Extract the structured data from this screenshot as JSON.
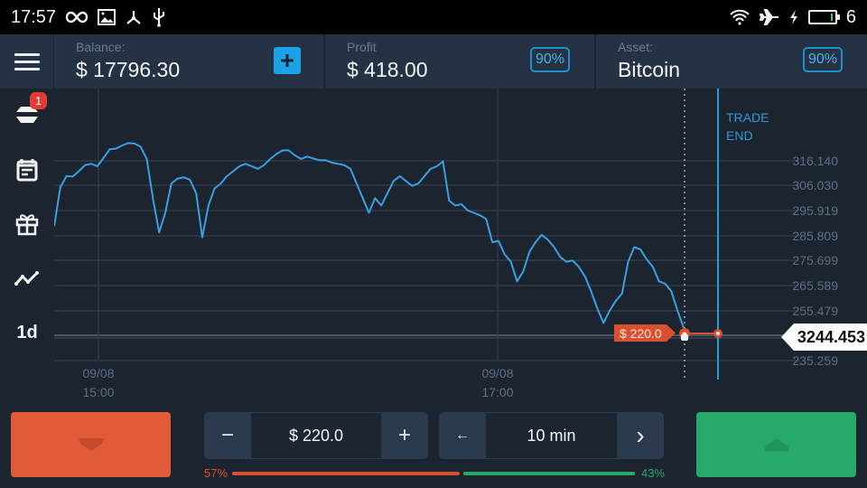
{
  "statusbar": {
    "time": "17:57",
    "left_icons": [
      "infinity-icon",
      "image-icon",
      "share-node-icon",
      "usb-icon"
    ],
    "right_icons": [
      "wifi-icon",
      "airplane-icon",
      "charging-bolt-icon",
      "battery-icon"
    ],
    "battery_level": "6"
  },
  "header": {
    "balance_label": "Balance:",
    "balance_value": "$ 17796.30",
    "profit_label": "Profit",
    "profit_value": "$ 418.00",
    "profit_percent": "90%",
    "asset_label": "Asset:",
    "asset_value": "Bitcoin",
    "asset_percent": "90%"
  },
  "sidebar": {
    "trades_badge": "1",
    "items": [
      "trades-icon",
      "calendar-icon",
      "gift-icon",
      "chart-line-icon"
    ],
    "timeframe": "1d"
  },
  "chart_data": {
    "type": "line",
    "title": "Bitcoin",
    "y_ticks": [
      "316.140",
      "306.030",
      "295.919",
      "285.809",
      "275.699",
      "265.589",
      "255.479",
      "235.259"
    ],
    "x_ticks": [
      {
        "date": "09/08",
        "time": "15:00"
      },
      {
        "date": "09/08",
        "time": "17:00"
      }
    ],
    "current_price": "3244.453",
    "trade_amount_tag": "$ 220.0",
    "trade_end_label": [
      "TRADE",
      "END"
    ],
    "ylim": [
      230,
      326
    ],
    "series": [
      {
        "name": "price",
        "color": "#3aa0e0",
        "values": [
          284.5,
          300.5,
          305,
          304.8,
          307,
          309.5,
          310,
          309,
          312.5,
          316,
          316.2,
          317.5,
          318.5,
          318.3,
          317,
          312,
          296,
          282,
          290,
          302,
          304,
          304.5,
          303.5,
          298,
          280,
          293,
          300,
          302,
          305,
          307,
          309,
          310,
          309,
          308,
          309.5,
          312,
          314,
          315.5,
          315.5,
          313.5,
          312,
          313,
          312.2,
          311.5,
          311.5,
          310.5,
          310,
          309.5,
          308,
          302,
          296,
          290,
          296,
          293,
          298,
          303,
          305,
          303,
          301,
          302,
          305,
          308,
          309,
          311,
          295,
          293,
          293.5,
          291,
          290,
          289,
          287.5,
          278,
          278.5,
          273,
          270,
          262,
          266,
          274,
          278,
          281,
          279,
          276,
          272,
          270,
          270.5,
          268,
          264,
          258,
          251,
          245,
          250,
          254,
          257,
          270,
          276,
          275,
          271,
          268,
          262,
          261,
          258,
          250,
          243
        ]
      }
    ]
  },
  "bottom": {
    "amount_minus": "−",
    "amount_value": "$ 220.0",
    "amount_plus": "+",
    "time_prev": "←",
    "time_value": "10 min",
    "time_next": "›",
    "sentiment_down": "57%",
    "sentiment_up": "43%",
    "down_color": "#e05a38",
    "up_color": "#27a96a"
  }
}
